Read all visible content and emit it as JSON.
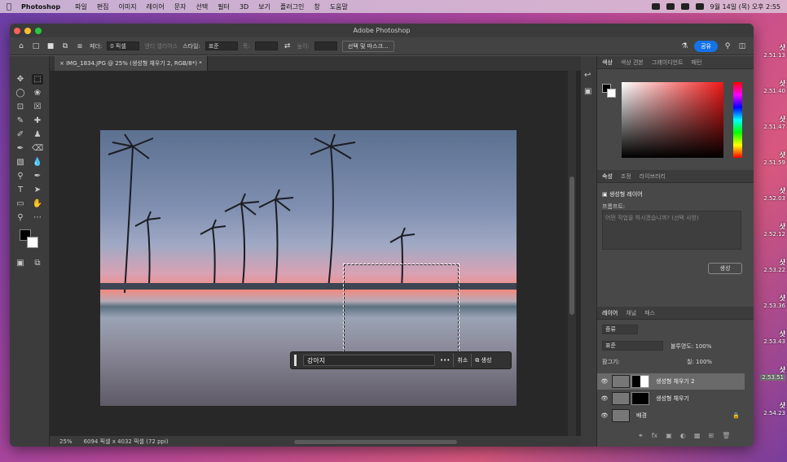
{
  "menubar": {
    "app": "Photoshop",
    "items": [
      "파일",
      "편집",
      "이미지",
      "레이어",
      "문자",
      "선택",
      "필터",
      "3D",
      "보기",
      "플러그인",
      "창",
      "도움말"
    ],
    "clock": "9월 14일 (목) 오후 2:55"
  },
  "desktop": {
    "files": [
      "2.51.13",
      "2.51.40",
      "2.51.47",
      "2.51.59",
      "2.52.03",
      "2.52.12",
      "2.53.22",
      "2.53.36",
      "2.53.43",
      "2.53.51",
      "2.54.23"
    ],
    "prefix": "샷"
  },
  "window": {
    "title": "Adobe Photoshop"
  },
  "options": {
    "feather_label": "페더:",
    "feather_value": "0 픽셀",
    "antialias": "앤티 앨리어스",
    "style_label": "스타일:",
    "style_value": "표준",
    "width_label": "폭:",
    "height_label": "높이:",
    "select_mask": "선택 및 마스크...",
    "share": "공유"
  },
  "doc": {
    "tab": "IMG_1834.JPG @ 25% (생성형 채우기 2, RGB/8*) *",
    "zoom": "25%",
    "info": "6094 픽셀 x 4032 픽셀 (72 ppi)"
  },
  "genbar": {
    "input": "강아지",
    "more": "•••",
    "cancel": "취소",
    "generate": "생성"
  },
  "color_panel": {
    "tabs": [
      "색상",
      "색상 견본",
      "그레이디언트",
      "패턴"
    ]
  },
  "props_panel": {
    "tabs": [
      "속성",
      "조정",
      "라이브러리"
    ],
    "layer_type": "생성형 레이어",
    "prompt_label": "프롬프트:",
    "prompt_placeholder": "어떤 작업을 하시겠습니까? (선택 사항)",
    "generate": "생성"
  },
  "layers_panel": {
    "tabs": [
      "레이어",
      "채널",
      "패스"
    ],
    "filter": "종류",
    "blend": "표준",
    "opacity_label": "불투명도:",
    "opacity": "100%",
    "lock_label": "잠그기:",
    "fill_label": "칠:",
    "fill": "100%",
    "layers": [
      {
        "name": "생성형 채우기 2",
        "selected": true
      },
      {
        "name": "생성형 채우기",
        "selected": false
      },
      {
        "name": "배경",
        "selected": false
      }
    ]
  }
}
